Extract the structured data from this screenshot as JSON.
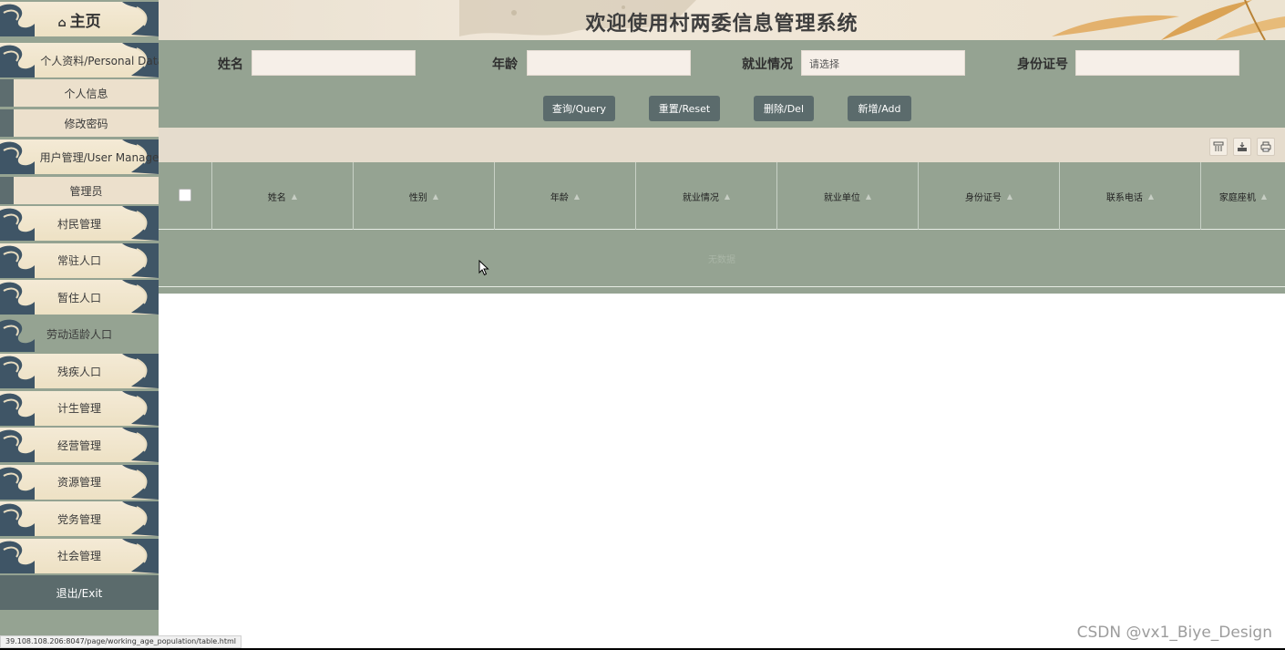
{
  "header": {
    "title": "欢迎使用村两委信息管理系统"
  },
  "sidebar": {
    "home": {
      "icon": "home-icon",
      "icon_glyph": "⌂",
      "label": "主页"
    },
    "personal": {
      "label": "个人资料/Personal Data",
      "items": [
        "个人信息",
        "修改密码"
      ]
    },
    "user_manage": {
      "label": "用户管理/User Manage",
      "items": [
        "管理员"
      ]
    },
    "menus": [
      "村民管理",
      "常驻人口",
      "暂住人口",
      "劳动适龄人口",
      "残疾人口",
      "计生管理",
      "经营管理",
      "资源管理",
      "党务管理",
      "社会管理"
    ],
    "active_menu": "劳动适龄人口",
    "exit": "退出/Exit"
  },
  "search": {
    "name": {
      "label": "姓名",
      "value": ""
    },
    "age": {
      "label": "年龄",
      "value": ""
    },
    "employment": {
      "label": "就业情况",
      "placeholder": "请选择"
    },
    "idcard": {
      "label": "身份证号",
      "value": ""
    },
    "buttons": {
      "query": "查询/Query",
      "reset": "重置/Reset",
      "delete": "删除/Del",
      "add": "新增/Add"
    }
  },
  "toolbar": {
    "icons": [
      "columns-icon",
      "export-icon",
      "print-icon"
    ]
  },
  "table": {
    "columns": [
      "姓名",
      "性别",
      "年龄",
      "就业情况",
      "就业单位",
      "身份证号",
      "联系电话",
      "家庭座机"
    ],
    "empty_text": "无数据"
  },
  "status_url": "39.108.108.206:8047/page/working_age_population/table.html",
  "watermark": "CSDN @vx1_Biye_Design",
  "colors": {
    "sage": "#95a392",
    "slate_button": "#5b6b6c",
    "cream": "#f4ead6",
    "toolbar": "#e5dccd"
  }
}
